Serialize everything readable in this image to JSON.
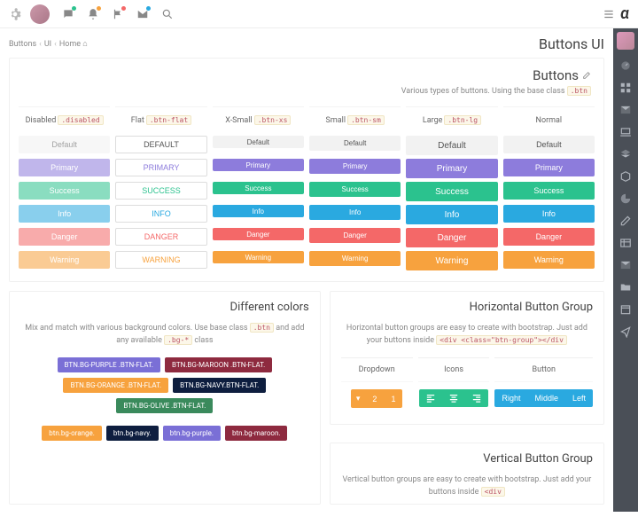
{
  "topbar": {
    "logo": "α"
  },
  "breadcrumb": [
    "Buttons",
    "UI",
    "Home"
  ],
  "pageTitle": "Buttons UI",
  "buttonsPanel": {
    "title": "Buttons",
    "subtitle_pre": "Various types of buttons. Using the base class ",
    "subtitle_code": ".btn",
    "columns": [
      {
        "label": "Disabled",
        "code": ".disabled"
      },
      {
        "label": "Flat",
        "code": ".btn-flat"
      },
      {
        "label": "X-Small",
        "code": ".btn-xs"
      },
      {
        "label": "Small",
        "code": ".btn-sm"
      },
      {
        "label": "Large",
        "code": ".btn-lg"
      },
      {
        "label": "Normal",
        "code": ""
      }
    ],
    "rows": [
      {
        "label": "Default",
        "cls": "def"
      },
      {
        "label": "Primary",
        "cls": "primary"
      },
      {
        "label": "Success",
        "cls": "success"
      },
      {
        "label": "Info",
        "cls": "info"
      },
      {
        "label": "Danger",
        "cls": "danger"
      },
      {
        "label": "Warning",
        "cls": "warning"
      }
    ]
  },
  "colorsPanel": {
    "title": "Different colors",
    "desc_pre": "Mix and match with various background colors. Use base class ",
    "desc_code1": ".btn",
    "desc_mid": " and add any available ",
    "desc_code2": ".bg-*",
    "desc_post": " class",
    "tags1": [
      {
        "t": "BTN.BG-PURPLE .BTN-FLAT.",
        "c": "bg-purple"
      },
      {
        "t": "BTN.BG-MAROON .BTN-FLAT.",
        "c": "bg-maroon"
      }
    ],
    "tags2": [
      {
        "t": "BTN.BG-ORANGE .BTN-FLAT.",
        "c": "bg-orange"
      },
      {
        "t": "BTN.BG-NAVY.BTN-FLAT.",
        "c": "bg-navy"
      }
    ],
    "tags3": [
      {
        "t": "BTN.BG-OLIVE .BTN-FLAT.",
        "c": "bg-olive"
      }
    ],
    "tags4": [
      {
        "t": "btn.bg-orange.",
        "c": "bg-orange"
      },
      {
        "t": "btn.bg-navy.",
        "c": "bg-navy"
      },
      {
        "t": "btn.bg-purple.",
        "c": "bg-purple"
      },
      {
        "t": "btn.bg-maroon.",
        "c": "bg-maroon"
      }
    ]
  },
  "hGroup": {
    "title": "Horizontal Button Group",
    "desc_pre": "Horizontal button groups are easy to create with bootstrap. Just add your buttons inside ",
    "desc_code": "<div <class=\"btn-group\"></div",
    "cols": [
      {
        "h": "Dropdown"
      },
      {
        "h": "Icons"
      },
      {
        "h": "Button"
      }
    ],
    "dropdown": [
      "",
      "2",
      "1"
    ],
    "icons": [
      "align-left",
      "align-center",
      "align-right"
    ],
    "buttons": [
      "Right",
      "Middle",
      "Left"
    ]
  },
  "vGroup": {
    "title": "Vertical Button Group",
    "desc_pre": "Vertical button groups are easy to create with bootstrap. Just add your buttons inside ",
    "desc_code": "<div"
  }
}
